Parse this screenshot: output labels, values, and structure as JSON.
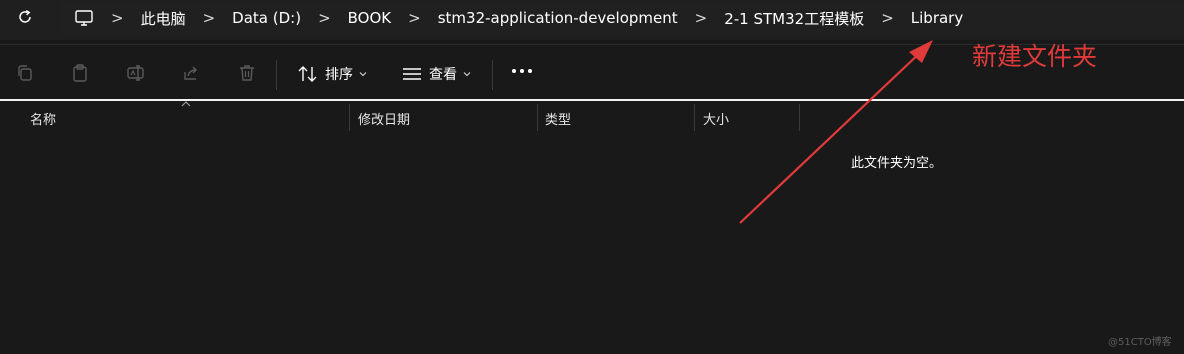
{
  "address_bar": {
    "breadcrumbs": [
      "此电脑",
      "Data (D:)",
      "BOOK",
      "stm32-application-development",
      "2-1 STM32工程模板",
      "Library"
    ],
    "separator": ">"
  },
  "toolbar": {
    "sort_label": "排序",
    "view_label": "查看",
    "icons": [
      "copy-icon",
      "paste-icon",
      "rename-icon",
      "share-icon",
      "delete-icon"
    ]
  },
  "columns": {
    "name": "名称",
    "modified": "修改日期",
    "type": "类型",
    "size": "大小"
  },
  "empty_message": "此文件夹为空。",
  "annotation": {
    "text": "新建文件夹",
    "color": "#e03a3a"
  },
  "watermark": "@51CTO博客",
  "colors": {
    "background": "#191919",
    "accent_red": "#e03a3a"
  }
}
